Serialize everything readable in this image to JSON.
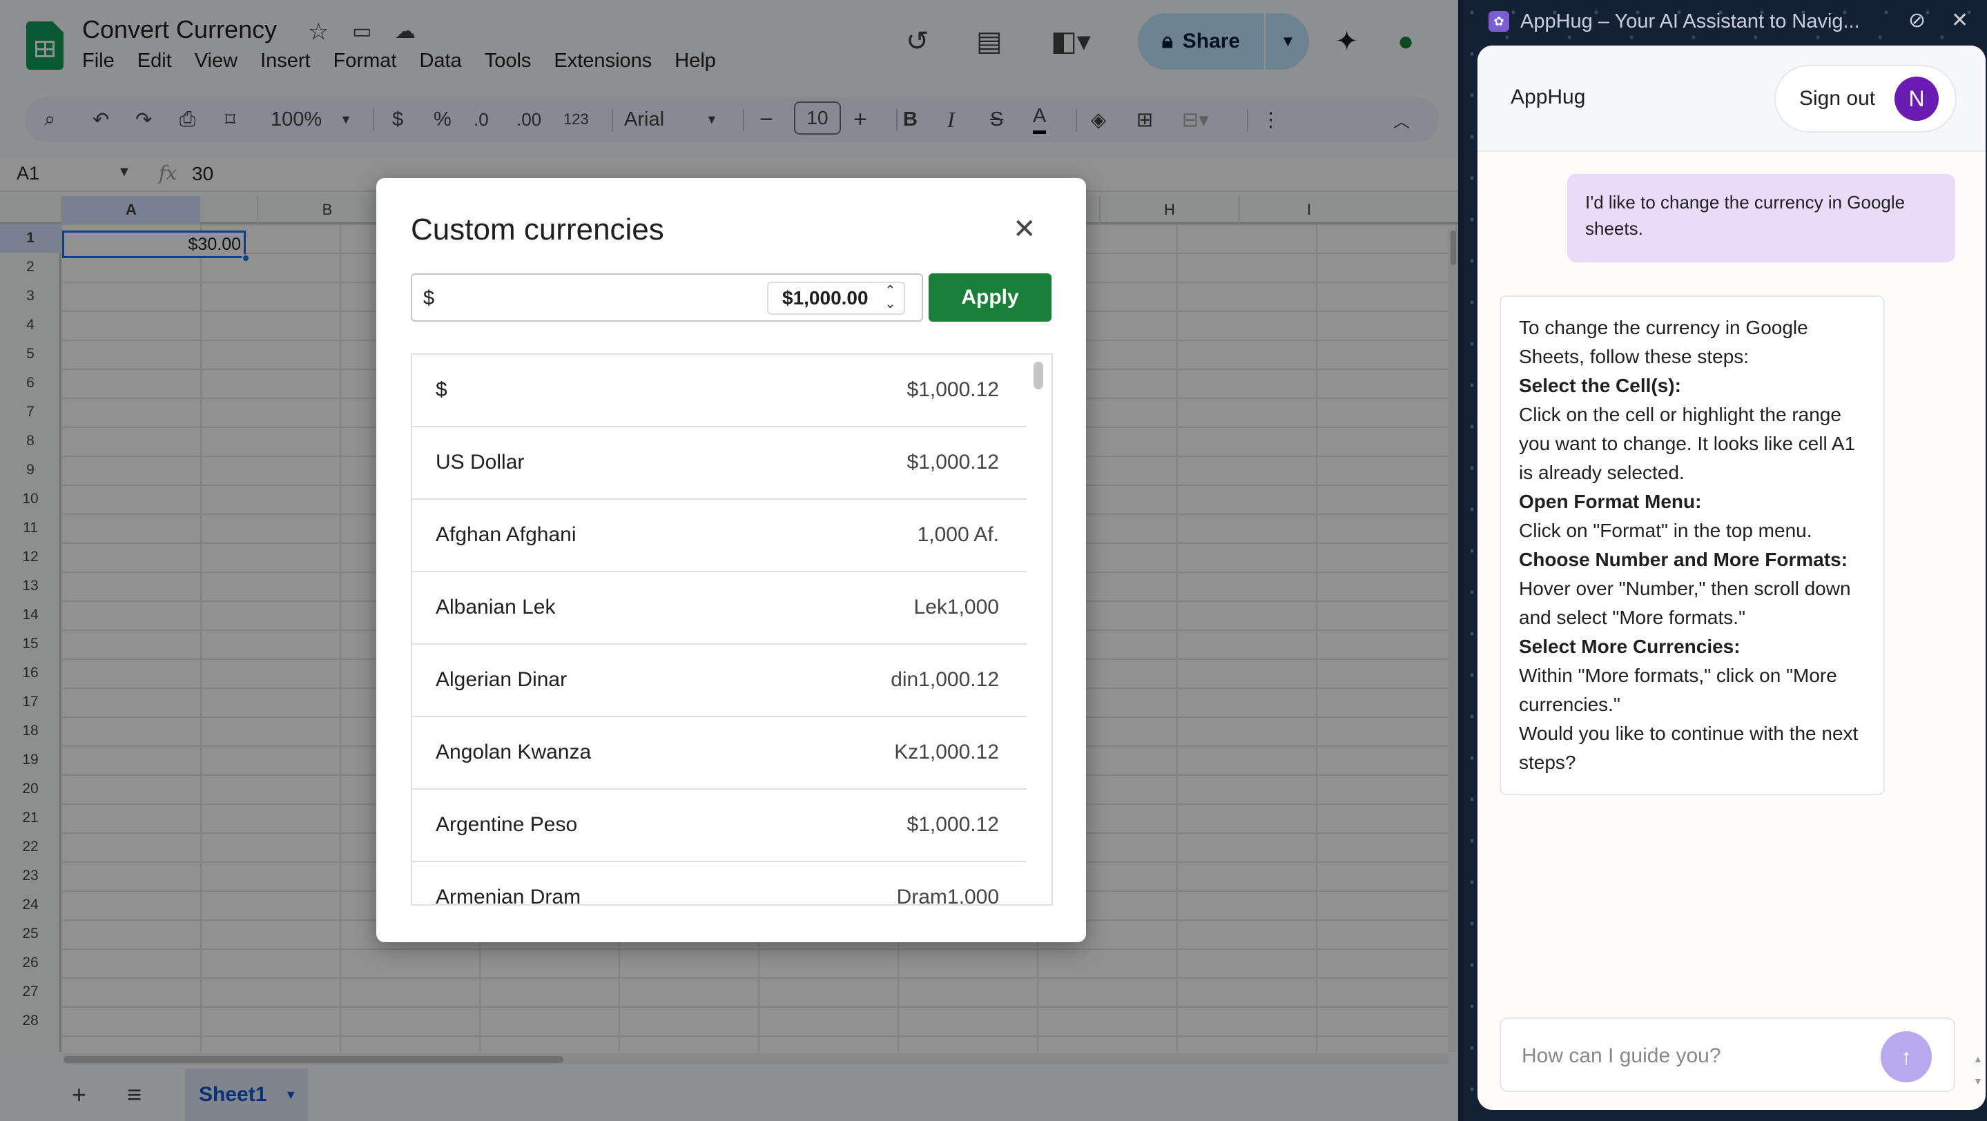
{
  "sheets": {
    "doc_title": "Convert Currency",
    "menu": [
      "File",
      "Edit",
      "View",
      "Insert",
      "Format",
      "Data",
      "Tools",
      "Extensions",
      "Help"
    ],
    "share_label": "Share",
    "toolbar": {
      "zoom": "100%",
      "currency": "$",
      "percent": "%",
      "dec_less": ".0",
      "dec_more": ".00",
      "number_format": "123",
      "font": "Arial",
      "font_size": "10",
      "bold": "B",
      "italic": "I",
      "strike": "S",
      "text_color": "A"
    },
    "name_box": "A1",
    "formula_value": "30",
    "columns": [
      "A",
      "B",
      "",
      "",
      "",
      "",
      "",
      "",
      "H",
      "I"
    ],
    "rows": [
      "1",
      "2",
      "3",
      "4",
      "5",
      "6",
      "7",
      "8",
      "9",
      "10",
      "11",
      "12",
      "13",
      "14",
      "15",
      "16",
      "17",
      "18",
      "19",
      "20",
      "21",
      "22",
      "23",
      "24",
      "25",
      "26",
      "27",
      "28"
    ],
    "selected_cell_value": "$30.00",
    "sheet_tab": "Sheet1"
  },
  "dialog": {
    "title": "Custom currencies",
    "input_value": "$",
    "format_preview": "$1,000.00",
    "apply_label": "Apply",
    "currencies": [
      {
        "name": "$",
        "value": "$1,000.12"
      },
      {
        "name": "US Dollar",
        "value": "$1,000.12"
      },
      {
        "name": "Afghan Afghani",
        "value": "1,000 Af."
      },
      {
        "name": "Albanian Lek",
        "value": "Lek1,000"
      },
      {
        "name": "Algerian Dinar",
        "value": "din1,000.12"
      },
      {
        "name": "Angolan Kwanza",
        "value": "Kz1,000.12"
      },
      {
        "name": "Argentine Peso",
        "value": "$1,000.12"
      },
      {
        "name": "Armenian Dram",
        "value": "Dram1,000"
      }
    ]
  },
  "apphug": {
    "tab_title": "AppHug – Your AI Assistant to Navig...",
    "brand": "AppHug",
    "sign_out": "Sign out",
    "avatar_initial": "N",
    "user_message": "I'd like to change the currency in Google sheets.",
    "bot_message": {
      "intro": "To change the currency in Google Sheets, follow these steps:",
      "step1_title": "Select the Cell(s):",
      "step1_text": "Click on the cell or highlight the range you want to change. It looks like cell A1 is already selected.",
      "step2_title": "Open Format Menu:",
      "step2_text": "Click on \"Format\" in the top menu.",
      "step3_title": "Choose Number and More Formats:",
      "step3_text": "Hover over \"Number,\" then scroll down and select \"More formats.\"",
      "step4_title": "Select More Currencies:",
      "step4_text": "Within \"More formats,\" click on \"More currencies.\"",
      "outro": "Would you like to continue with the next steps?"
    },
    "input_placeholder": "How can I guide you?"
  },
  "colors": {
    "sheets_green": "#0f9d58",
    "selection_blue": "#1a73e8",
    "apply_green": "#188038",
    "share_bg": "#c2e7ff",
    "avatar_purple": "#6a1bb4",
    "user_bubble": "#e7ddfb",
    "send_button": "#b8a8ee"
  },
  "icons": [
    "star-icon",
    "move-folder-icon",
    "cloud-status-icon",
    "history-icon",
    "comment-icon",
    "meet-icon",
    "lock-icon",
    "gemini-icon",
    "account-icon",
    "search-icon",
    "undo-icon",
    "redo-icon",
    "print-icon",
    "paint-format-icon",
    "fill-color-icon",
    "borders-icon",
    "merge-icon",
    "more-icon",
    "collapse-icon",
    "close-icon",
    "add-sheet-icon",
    "sheet-list-icon",
    "send-icon",
    "unpin-icon"
  ]
}
